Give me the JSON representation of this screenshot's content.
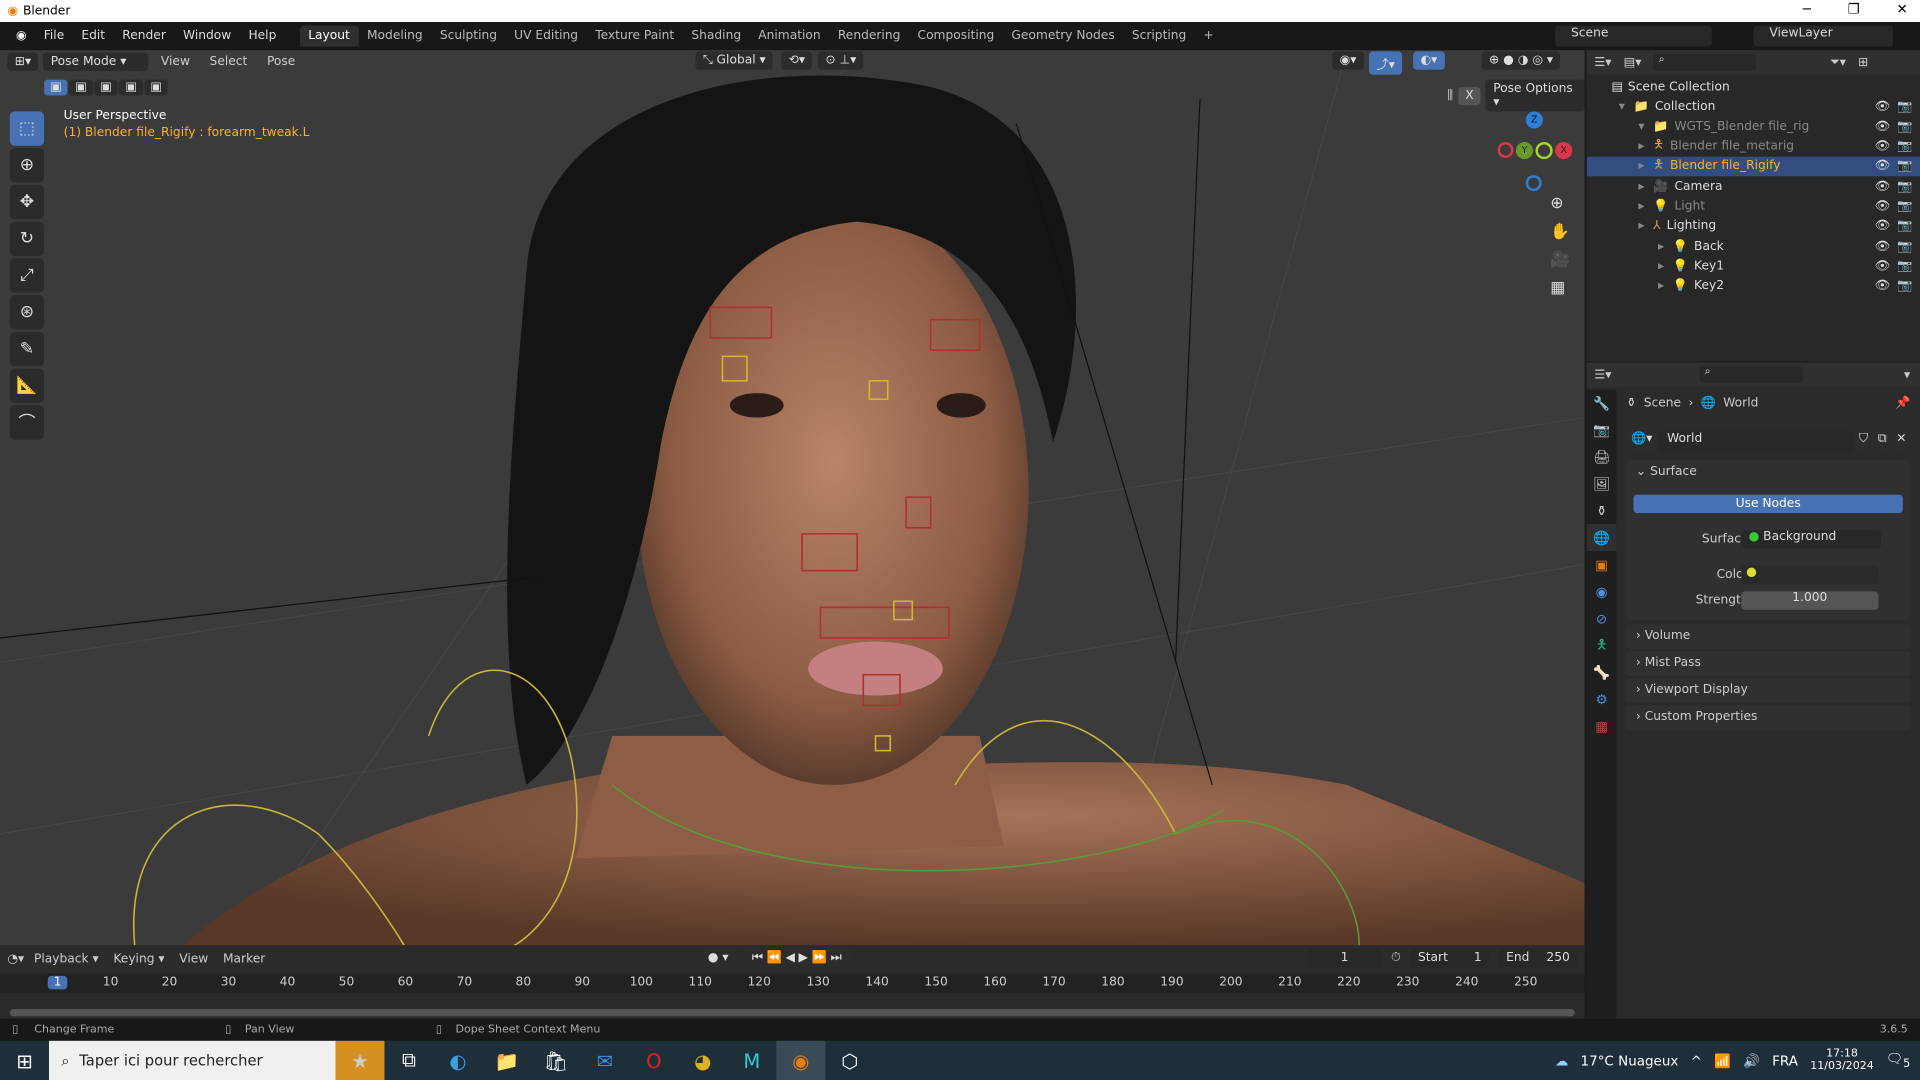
{
  "window": {
    "title": "Blender",
    "min": "─",
    "max": "❐",
    "close": "✕"
  },
  "menu": [
    "File",
    "Edit",
    "Render",
    "Window",
    "Help"
  ],
  "workspaces": [
    "Layout",
    "Modeling",
    "Sculpting",
    "UV Editing",
    "Texture Paint",
    "Shading",
    "Animation",
    "Rendering",
    "Compositing",
    "Geometry Nodes",
    "Scripting",
    "+"
  ],
  "scene": "Scene",
  "view_layer": "ViewLayer",
  "viewport": {
    "mode": "Pose Mode",
    "menus": [
      "View",
      "Select",
      "Pose"
    ],
    "orientation": "Global",
    "pose_options": "Pose Options",
    "x_label": "X",
    "perspective": "User Perspective",
    "active": "(1) Blender file_Rigify : forearm_tweak.L",
    "gizmo": {
      "z": "Z",
      "y": "Y",
      "x": "X"
    }
  },
  "outliner": {
    "root": "Scene Collection",
    "items": [
      {
        "name": "Collection",
        "depth": 0,
        "icon": "📁"
      },
      {
        "name": "WGTS_Blender file_rig",
        "depth": 1,
        "icon": "📁"
      },
      {
        "name": "Blender file_metarig",
        "depth": 1,
        "icon": "🯅"
      },
      {
        "name": "Blender file_Rigify",
        "depth": 1,
        "icon": "🯅",
        "selected": true
      },
      {
        "name": "Camera",
        "depth": 1,
        "icon": "🎥"
      },
      {
        "name": "Light",
        "depth": 1,
        "icon": "💡"
      },
      {
        "name": "Lighting",
        "depth": 1,
        "icon": "⅄"
      },
      {
        "name": "Back",
        "depth": 2,
        "icon": "💡"
      },
      {
        "name": "Key1",
        "depth": 2,
        "icon": "💡"
      },
      {
        "name": "Key2",
        "depth": 2,
        "icon": "💡"
      }
    ]
  },
  "properties": {
    "breadcrumb": [
      "Scene",
      "World"
    ],
    "world_name": "World",
    "surface_header": "Surface",
    "use_nodes": "Use Nodes",
    "surface_label": "Surface",
    "surface_value": "Background",
    "color_label": "Color",
    "strength_label": "Strength",
    "strength_value": "1.000",
    "panels": [
      "Volume",
      "Mist Pass",
      "Viewport Display",
      "Custom Properties"
    ]
  },
  "timeline": {
    "menus": [
      "Playback",
      "Keying",
      "View",
      "Marker"
    ],
    "current_frame": "1",
    "start_label": "Start",
    "start": "1",
    "end_label": "End",
    "end": "250",
    "ticks": [
      "1",
      "10",
      "20",
      "30",
      "40",
      "50",
      "60",
      "70",
      "80",
      "90",
      "100",
      "110",
      "120",
      "130",
      "140",
      "150",
      "160",
      "170",
      "180",
      "190",
      "200",
      "210",
      "220",
      "230",
      "240",
      "250"
    ]
  },
  "status": {
    "left": "Change Frame",
    "mid": "Pan View",
    "right": "Dope Sheet Context Menu",
    "version": "3.6.5"
  },
  "taskbar": {
    "search": "Taper ici pour rechercher",
    "weather": "17°C  Nuageux",
    "lang": "FRA",
    "time": "17:18",
    "date": "11/03/2024",
    "notif": "5"
  },
  "colors": {
    "accent": "#4772b3",
    "selected_row": "#334d80",
    "active_text": "#ffaf29"
  }
}
